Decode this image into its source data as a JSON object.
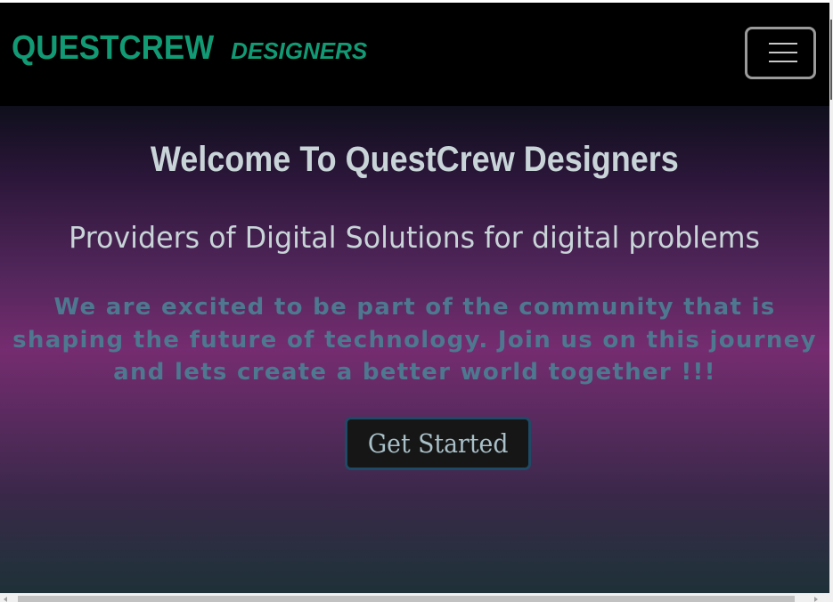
{
  "navbar": {
    "brand_main": "QUESTCREW",
    "brand_sub": "DESIGNERS",
    "toggler_icon": "hamburger-menu-icon"
  },
  "hero": {
    "title": "Welcome To QuestCrew Designers",
    "subtitle": "Providers of Digital Solutions for digital problems",
    "text": "We are excited to be part of the community that is shaping the future of technology. Join us on this journey and lets create a better world together !!!",
    "cta_label": "Get Started"
  },
  "colors": {
    "brand": "#129a74",
    "navbar_bg": "#000000",
    "hero_title": "#c8d4d8",
    "hero_text": "#4d7890",
    "cta_bg": "#161616",
    "cta_border": "#1f4a65"
  }
}
